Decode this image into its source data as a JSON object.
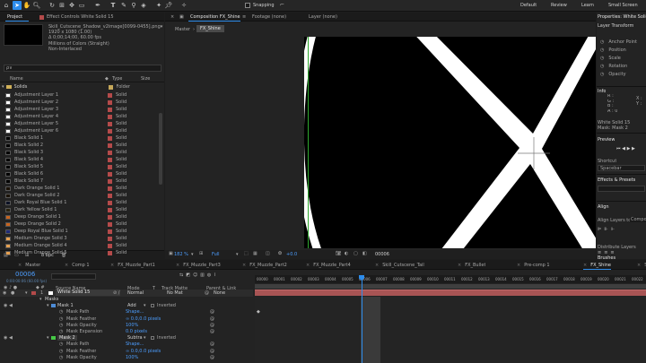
{
  "toolbar": {
    "snapping": "Snapping"
  },
  "workspaces": {
    "default": "Default",
    "review": "Review",
    "learn": "Learn",
    "small": "Small Screen"
  },
  "project": {
    "tab_project": "Project",
    "tab_effect": "Effect Controls White Solid 15",
    "info_lines": [
      "Skill_Cutscene_Shadow_v2image[0099-0455].png▾",
      "1920 x 1080 (1.00)",
      "Δ 0;00;14;00, 60.00 fps",
      "Millions of Colors (Straight)",
      "Non-Interlaced"
    ],
    "search_placeholder": "ρ∨",
    "col_name": "Name",
    "col_type": "Type",
    "col_size": "Size",
    "folder": "Solids",
    "folder_type": "Folder",
    "items": [
      {
        "name": "Adjustment Layer 1",
        "type": "Solid",
        "sw": "#ffffff",
        "label": "#b44a4a"
      },
      {
        "name": "Adjustment Layer 2",
        "type": "Solid",
        "sw": "#ffffff",
        "label": "#b44a4a"
      },
      {
        "name": "Adjustment Layer 3",
        "type": "Solid",
        "sw": "#ffffff",
        "label": "#b44a4a"
      },
      {
        "name": "Adjustment Layer 4",
        "type": "Solid",
        "sw": "#ffffff",
        "label": "#b44a4a"
      },
      {
        "name": "Adjustment Layer 5",
        "type": "Solid",
        "sw": "#ffffff",
        "label": "#b44a4a"
      },
      {
        "name": "Adjustment Layer 6",
        "type": "Solid",
        "sw": "#ffffff",
        "label": "#b44a4a"
      },
      {
        "name": "Black Solid 1",
        "type": "Solid",
        "sw": "#000000",
        "label": "#b44a4a"
      },
      {
        "name": "Black Solid 2",
        "type": "Solid",
        "sw": "#000000",
        "label": "#b44a4a"
      },
      {
        "name": "Black Solid 3",
        "type": "Solid",
        "sw": "#000000",
        "label": "#b44a4a"
      },
      {
        "name": "Black Solid 4",
        "type": "Solid",
        "sw": "#000000",
        "label": "#b44a4a"
      },
      {
        "name": "Black Solid 5",
        "type": "Solid",
        "sw": "#000000",
        "label": "#b44a4a"
      },
      {
        "name": "Black Solid 6",
        "type": "Solid",
        "sw": "#000000",
        "label": "#b44a4a"
      },
      {
        "name": "Black Solid 7",
        "type": "Solid",
        "sw": "#000000",
        "label": "#b44a4a"
      },
      {
        "name": "Dark Orange Solid 1",
        "type": "Solid",
        "sw": "#1a1208",
        "label": "#b44a4a"
      },
      {
        "name": "Dark Orange Solid 2",
        "type": "Solid",
        "sw": "#1a1208",
        "label": "#b44a4a"
      },
      {
        "name": "Dark Royal Blue Solid 1",
        "type": "Solid",
        "sw": "#0d1226",
        "label": "#b44a4a"
      },
      {
        "name": "Dark Yellow Solid 1",
        "type": "Solid",
        "sw": "#2a2410",
        "label": "#b44a4a"
      },
      {
        "name": "Deep Orange Solid 1",
        "type": "Solid",
        "sw": "#c8641e",
        "label": "#b44a4a"
      },
      {
        "name": "Deep Orange Solid 2",
        "type": "Solid",
        "sw": "#c8641e",
        "label": "#b44a4a"
      },
      {
        "name": "Deep Royal Blue Solid 1",
        "type": "Solid",
        "sw": "#1e2a78",
        "label": "#b44a4a"
      },
      {
        "name": "Medium Orange Solid 3",
        "type": "Solid",
        "sw": "#e6a050",
        "label": "#b44a4a"
      },
      {
        "name": "Medium Orange Solid 4",
        "type": "Solid",
        "sw": "#e6a050",
        "label": "#b44a4a"
      },
      {
        "name": "Medium Orange Solid 5",
        "type": "Solid",
        "sw": "#e6a050",
        "label": "#b44a4a"
      }
    ],
    "bpc": "8 bpc"
  },
  "viewer": {
    "tab_comp": "Composition FX_Shine",
    "tab_footage": "Footage (none)",
    "tab_layer": "Layer (none)",
    "crumb_master": "Master",
    "crumb_fx": "FX_Shine",
    "zoom": "182 %",
    "resolution": "Full",
    "exposure": "+0.0",
    "timecode": "00006"
  },
  "timeline": {
    "tabs": [
      "Master",
      "Comp 1",
      "FX_Muzzle_Part1",
      "FX_Muzzle_Part3",
      "FX_Muzzle_Part2",
      "FX_Muzzle_Part4",
      "Skill_Cutscene_Tail",
      "FX_Bullet",
      "Pre-comp 1",
      "FX_Shine",
      "ScreenFX_Speedline",
      "Speedline"
    ],
    "active_tab": 9,
    "current_time": "00006",
    "fps": "0:00:00:06 (60.00 fps)",
    "col_source": "Source Name",
    "col_mode": "Mode",
    "col_t": "T",
    "col_trkmat": "Track Matte",
    "col_parent": "Parent & Link",
    "ruler": [
      "00000",
      "00001",
      "00002",
      "00003",
      "00004",
      "00005",
      "00006",
      "00007",
      "00008",
      "00009",
      "00010",
      "00011",
      "00012",
      "00013",
      "00014",
      "00015",
      "00016",
      "00017",
      "00018",
      "00019",
      "00020",
      "00021",
      "00022",
      "00023"
    ],
    "layer": {
      "num": "1",
      "name": "White Solid 15",
      "mode": "Normal",
      "trkmat": "No Mat",
      "parent": "None"
    },
    "props": [
      {
        "name": "Masks",
        "indent": 0
      },
      {
        "name": "Mask 1",
        "indent": 1,
        "mode": "Add",
        "extra": "Inverted",
        "mask": true,
        "color": "#4d8cd6"
      },
      {
        "name": "Mask Path",
        "indent": 2,
        "value": "Shape..."
      },
      {
        "name": "Mask Feather",
        "indent": 2,
        "value": "∞ 0.0,0.0 pixels"
      },
      {
        "name": "Mask Opacity",
        "indent": 2,
        "value": "100%"
      },
      {
        "name": "Mask Expansion",
        "indent": 2,
        "value": "0.0 pixels"
      },
      {
        "name": "Mask 2",
        "indent": 1,
        "mode": "Subtra",
        "extra": "Inverted",
        "mask": true,
        "color": "#46c846"
      },
      {
        "name": "Mask Path",
        "indent": 2,
        "value": "Shape..."
      },
      {
        "name": "Mask Feather",
        "indent": 2,
        "value": "∞ 0.0,0.0 pixels"
      },
      {
        "name": "Mask Opacity",
        "indent": 2,
        "value": "100%"
      }
    ]
  },
  "right": {
    "properties_title": "Properties: White Solid 15",
    "layer_transform": "Layer Transform",
    "transform": [
      "Anchor Point",
      "Position",
      "Scale",
      "Rotation",
      "Opacity"
    ],
    "info": "Info",
    "rgba": [
      "R :",
      "G :",
      "B :",
      "A : 0"
    ],
    "xy": [
      "X :",
      "Y :"
    ],
    "info_line1": "White Solid 15",
    "info_line2": "Mask: Mask 2",
    "preview": "Preview",
    "shortcut": "Shortcut",
    "shortcut_value": "Spacebar",
    "effects": "Effects & Presets",
    "align": "Align",
    "align_to": "Align Layers to:",
    "align_val": "Compo",
    "distribute": "Distribute Layers",
    "brushes": "Brushes"
  }
}
